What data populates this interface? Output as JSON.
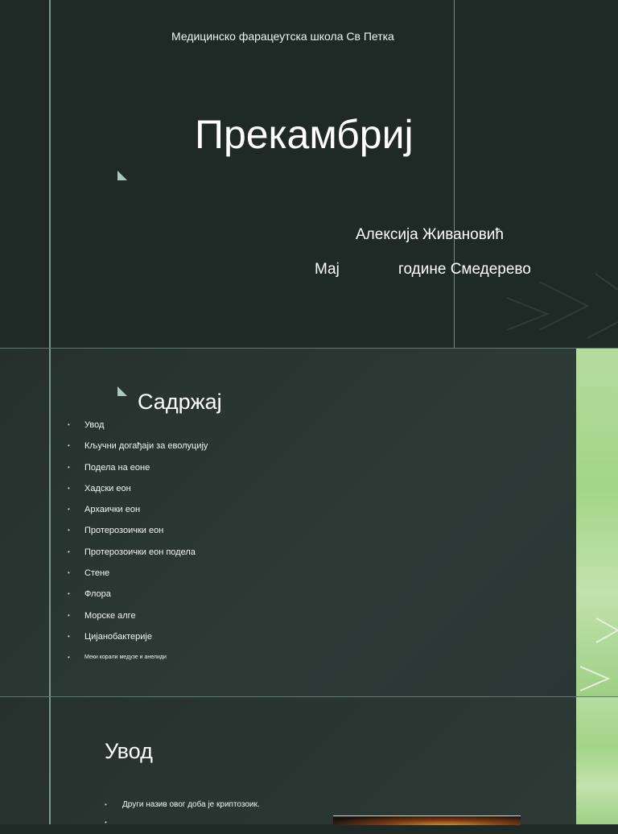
{
  "slide1": {
    "school": "Медицинско фарацеутска школа  Св  Петка",
    "title": "Прекамбриј",
    "author": "Алексија Живановић",
    "date_month": "Мај",
    "date_rest": "године  Смедерево"
  },
  "slide2": {
    "heading": "Садржај",
    "items": [
      "Увод",
      "Кључни догађаји за еволуцију",
      "Подела на еоне",
      "Хадски еон",
      "Архаички еон",
      "Протерозоички еон",
      "Протерозоички еон подела",
      "Стене",
      "Флора",
      "Морске алге",
      "Цијанобактерије",
      "Меки корали медузе и анелиди"
    ]
  },
  "slide3": {
    "heading": "Увод",
    "bullets": [
      "Други назив овог доба је криптозоик."
    ]
  },
  "colors": {
    "background": "#1f2a27",
    "accent_line": "#7c978f",
    "green_strip": "#a3d587",
    "triangle": "#aec8c2"
  }
}
